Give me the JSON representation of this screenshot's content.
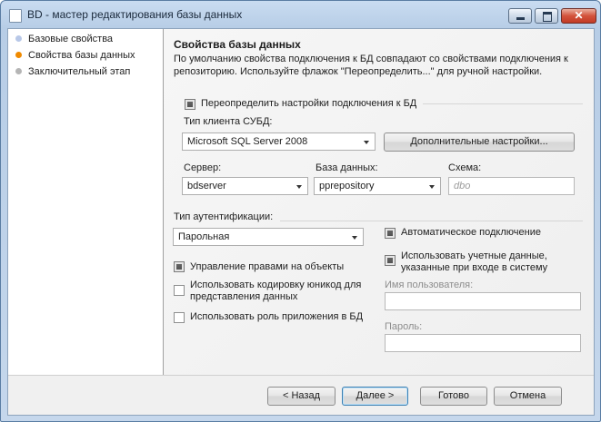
{
  "window": {
    "title": "BD - мастер редактирования базы данных",
    "close_glyph": "✕"
  },
  "nav": {
    "items": [
      {
        "label": "Базовые свойства",
        "color": "#b8c8e8"
      },
      {
        "label": "Свойства базы данных",
        "color": "#f08a00"
      },
      {
        "label": "Заключительный этап",
        "color": "#b5b5b5"
      }
    ]
  },
  "main": {
    "heading": "Свойства базы данных",
    "description": "По умолчанию свойства подключения к БД совпадают со свойствами подключения к репозиторию. Используйте флажок \"Переопределить...\" для ручной настройки.",
    "override_label": "Переопределить настройки подключения к БД",
    "client_type_label": "Тип клиента СУБД:",
    "client_type_value": "Microsoft SQL Server 2008",
    "advanced_button": "Дополнительные настройки...",
    "server_label": "Сервер:",
    "server_value": "bdserver",
    "database_label": "База данных:",
    "database_value": "pprepository",
    "schema_label": "Схема:",
    "schema_placeholder": "dbo",
    "auth_label": "Тип аутентификации:",
    "auth_value": "Парольная",
    "auto_connect_label": "Автоматическое подключение",
    "use_credentials_label_1": "Использовать учетные данные,",
    "use_credentials_label_2": "указанные при входе в систему",
    "manage_rights_label": "Управление правами на объекты",
    "unicode_label_1": "Использовать кодировку юникод для",
    "unicode_label_2": "представления данных",
    "app_role_label": "Использовать роль приложения в БД",
    "username_label": "Имя пользователя:",
    "password_label": "Пароль:"
  },
  "footer": {
    "back": "< Назад",
    "next": "Далее >",
    "finish": "Готово",
    "cancel": "Отмена"
  }
}
